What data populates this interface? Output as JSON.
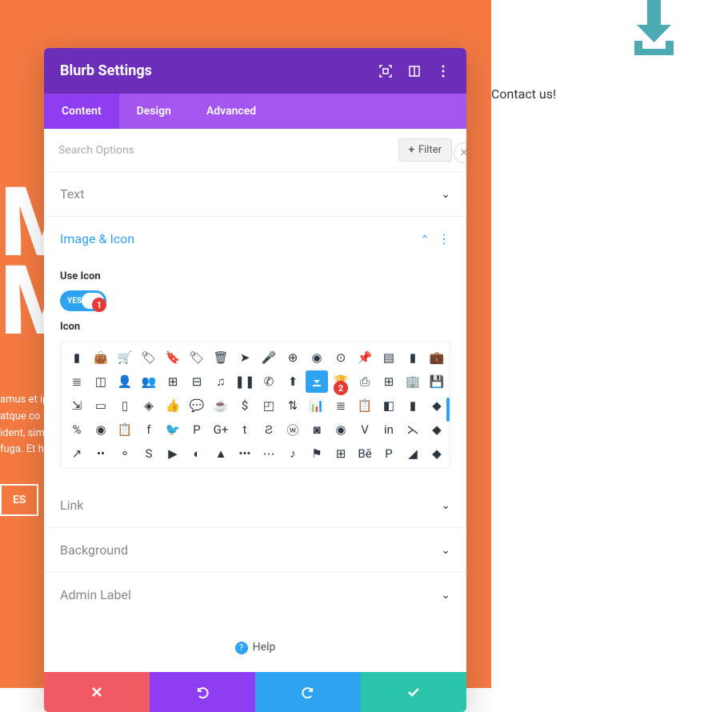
{
  "header": {
    "title": "Blurb Settings"
  },
  "tabs": {
    "content": "Content",
    "design": "Design",
    "advanced": "Advanced",
    "active": "content"
  },
  "search": {
    "placeholder": "Search Options",
    "filter_label": "Filter"
  },
  "sections": {
    "text": {
      "title": "Text"
    },
    "image_icon": {
      "title": "Image & Icon",
      "use_icon_label": "Use Icon",
      "use_icon_value": "YES",
      "icon_label": "Icon",
      "selected_icon": "download"
    },
    "link": {
      "title": "Link"
    },
    "background": {
      "title": "Background"
    },
    "admin_label": {
      "title": "Admin Label"
    }
  },
  "icon_grid": [
    "bookmark",
    "bag",
    "cart",
    "tag",
    "tag2",
    "tags",
    "trash",
    "cursor",
    "mic",
    "compass",
    "pin",
    "pin2",
    "thumbtack",
    "doc",
    "bookmark2",
    "briefcase",
    "stack",
    "group",
    "user",
    "users",
    "th",
    "grid",
    "music",
    "pause",
    "phone",
    "upload",
    "download",
    "trophy",
    "print",
    "calc",
    "building",
    "save",
    "collapse",
    "laptop",
    "tablet",
    "shapes",
    "like",
    "comment",
    "coffee",
    "dollar",
    "wallet",
    "people",
    "chart",
    "database",
    "clipboard",
    "cube",
    "bars",
    "offset",
    "percent",
    "circle",
    "paste",
    "facebook",
    "twitter",
    "pinterest",
    "gplus",
    "tumblr",
    "stumble",
    "wordpress",
    "instagram",
    "dribbble",
    "vimeo",
    "linkedin",
    "rss",
    "offset2",
    "share",
    "flickr",
    "myspace",
    "skype",
    "youtube",
    "picasa",
    "drive",
    "dots1",
    "dots2",
    "spotify",
    "flagcircle",
    "windows",
    "behance",
    "paypal",
    "deviant",
    "offset3"
  ],
  "markers": {
    "m1": "1",
    "m2": "2"
  },
  "help": {
    "label": "Help"
  },
  "page": {
    "contact": "Contact us!",
    "lorem": "amus et ipsa atque co ident, sim n fuga. Et h",
    "btn": "ES"
  },
  "colors": {
    "orange": "#f47a42",
    "purple_dark": "#6c2eb9",
    "purple": "#a455f0",
    "purple_active": "#8e3df2",
    "blue": "#2ea3f2",
    "teal": "#29c4a9",
    "red": "#ef5a63",
    "icon": "#2b3641",
    "teal_arrow": "#4caab3"
  }
}
